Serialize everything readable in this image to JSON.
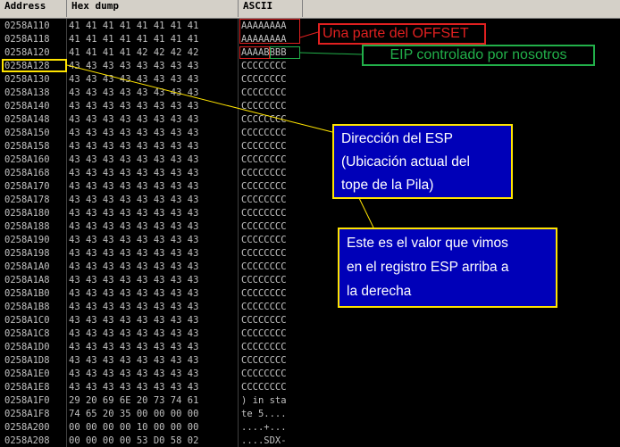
{
  "header": {
    "address": "Address",
    "hexdump": "Hex dump",
    "ascii": "ASCII"
  },
  "rows": [
    {
      "addr": "0258A110",
      "hex": "41 41 41 41 41 41 41 41",
      "ascii": "AAAAAAAA"
    },
    {
      "addr": "0258A118",
      "hex": "41 41 41 41 41 41 41 41",
      "ascii": "AAAAAAAA"
    },
    {
      "addr": "0258A120",
      "hex": "41 41 41 41 42 42 42 42",
      "ascii": "AAAABBBB"
    },
    {
      "addr": "0258A128",
      "hex": "43 43 43 43 43 43 43 43",
      "ascii": "CCCCCCCC"
    },
    {
      "addr": "0258A130",
      "hex": "43 43 43 43 43 43 43 43",
      "ascii": "CCCCCCCC"
    },
    {
      "addr": "0258A138",
      "hex": "43 43 43 43 43 43 43 43",
      "ascii": "CCCCCCCC"
    },
    {
      "addr": "0258A140",
      "hex": "43 43 43 43 43 43 43 43",
      "ascii": "CCCCCCCC"
    },
    {
      "addr": "0258A148",
      "hex": "43 43 43 43 43 43 43 43",
      "ascii": "CCCCCCCC"
    },
    {
      "addr": "0258A150",
      "hex": "43 43 43 43 43 43 43 43",
      "ascii": "CCCCCCCC"
    },
    {
      "addr": "0258A158",
      "hex": "43 43 43 43 43 43 43 43",
      "ascii": "CCCCCCCC"
    },
    {
      "addr": "0258A160",
      "hex": "43 43 43 43 43 43 43 43",
      "ascii": "CCCCCCCC"
    },
    {
      "addr": "0258A168",
      "hex": "43 43 43 43 43 43 43 43",
      "ascii": "CCCCCCCC"
    },
    {
      "addr": "0258A170",
      "hex": "43 43 43 43 43 43 43 43",
      "ascii": "CCCCCCCC"
    },
    {
      "addr": "0258A178",
      "hex": "43 43 43 43 43 43 43 43",
      "ascii": "CCCCCCCC"
    },
    {
      "addr": "0258A180",
      "hex": "43 43 43 43 43 43 43 43",
      "ascii": "CCCCCCCC"
    },
    {
      "addr": "0258A188",
      "hex": "43 43 43 43 43 43 43 43",
      "ascii": "CCCCCCCC"
    },
    {
      "addr": "0258A190",
      "hex": "43 43 43 43 43 43 43 43",
      "ascii": "CCCCCCCC"
    },
    {
      "addr": "0258A198",
      "hex": "43 43 43 43 43 43 43 43",
      "ascii": "CCCCCCCC"
    },
    {
      "addr": "0258A1A0",
      "hex": "43 43 43 43 43 43 43 43",
      "ascii": "CCCCCCCC"
    },
    {
      "addr": "0258A1A8",
      "hex": "43 43 43 43 43 43 43 43",
      "ascii": "CCCCCCCC"
    },
    {
      "addr": "0258A1B0",
      "hex": "43 43 43 43 43 43 43 43",
      "ascii": "CCCCCCCC"
    },
    {
      "addr": "0258A1B8",
      "hex": "43 43 43 43 43 43 43 43",
      "ascii": "CCCCCCCC"
    },
    {
      "addr": "0258A1C0",
      "hex": "43 43 43 43 43 43 43 43",
      "ascii": "CCCCCCCC"
    },
    {
      "addr": "0258A1C8",
      "hex": "43 43 43 43 43 43 43 43",
      "ascii": "CCCCCCCC"
    },
    {
      "addr": "0258A1D0",
      "hex": "43 43 43 43 43 43 43 43",
      "ascii": "CCCCCCCC"
    },
    {
      "addr": "0258A1D8",
      "hex": "43 43 43 43 43 43 43 43",
      "ascii": "CCCCCCCC"
    },
    {
      "addr": "0258A1E0",
      "hex": "43 43 43 43 43 43 43 43",
      "ascii": "CCCCCCCC"
    },
    {
      "addr": "0258A1E8",
      "hex": "43 43 43 43 43 43 43 43",
      "ascii": "CCCCCCCC"
    },
    {
      "addr": "0258A1F0",
      "hex": "29 20 69 6E 20 73 74 61",
      "ascii": ") in sta"
    },
    {
      "addr": "0258A1F8",
      "hex": "74 65 20 35 00 00 00 00",
      "ascii": "te 5...."
    },
    {
      "addr": "0258A200",
      "hex": "00 00 00 00 10 00 00 00",
      "ascii": "....+..."
    },
    {
      "addr": "0258A208",
      "hex": "00 00 00 00 53 D0 58 02",
      "ascii": "....SDX-"
    }
  ],
  "annotations": {
    "offset_label": "Una parte del OFFSET",
    "eip_label": "EIP controlado por nosotros",
    "esp_lines": [
      "Dirección del ESP",
      "(Ubicación actual del",
      "tope de la Pila)"
    ],
    "value_lines": [
      "Este es el valor que vimos",
      "en el registro ESP arriba a",
      "la derecha"
    ]
  },
  "colors": {
    "background": "#000000",
    "text": "#c0c0c0",
    "header_bg": "#d4d0c8",
    "offset_red": "#e02020",
    "eip_green": "#22b04a",
    "callout_yellow": "#ffe400",
    "callout_fill": "#0000b8"
  }
}
